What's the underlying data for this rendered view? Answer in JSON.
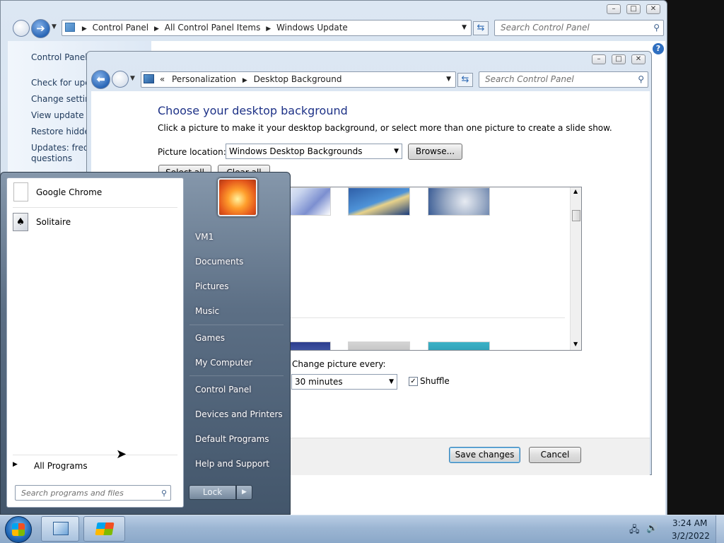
{
  "windows_update": {
    "address": {
      "crumbs": [
        "Control Panel",
        "All Control Panel Items",
        "Windows Update"
      ]
    },
    "search_placeholder": "Search Control Panel",
    "sidebar": {
      "home": "Control Panel H",
      "items": [
        "Check for upda",
        "Change setting",
        "View update hi",
        "Restore hidden",
        "Updates: freque"
      ],
      "items_cont": "questions"
    }
  },
  "personalization": {
    "address": {
      "prefix": "«",
      "crumbs": [
        "Personalization",
        "Desktop Background"
      ]
    },
    "search_placeholder": "Search Control Panel",
    "heading": "Choose your desktop background",
    "instruction": "Click a picture to make it your desktop background, or select more than one picture to create a slide show.",
    "picture_location_label": "Picture location:",
    "picture_location_value": "Windows Desktop Backgrounds",
    "browse_label": "Browse...",
    "select_all_label": "Select all",
    "clear_all_label": "Clear all",
    "change_picture_label": "Change picture every:",
    "interval_value": "30 minutes",
    "shuffle_label": "Shuffle",
    "shuffle_checked": "✓",
    "save_label": "Save changes",
    "cancel_label": "Cancel"
  },
  "start_menu": {
    "pinned": [
      {
        "label": "Google Chrome",
        "icon": "chrome-file-icon"
      },
      {
        "label": "Solitaire",
        "icon": "solitaire-icon"
      }
    ],
    "all_programs": "All Programs",
    "search_placeholder": "Search programs and files",
    "right_items": [
      "VM1",
      "Documents",
      "Pictures",
      "Music",
      "Games",
      "My Computer",
      "Control Panel",
      "Devices and Printers",
      "Default Programs",
      "Help and Support"
    ],
    "lock_label": "Lock"
  },
  "taskbar": {
    "time": "3:24 AM",
    "date": "3/2/2022"
  },
  "colors": {
    "accent_heading": "#1e3287",
    "start_menu_panel": "#4a5c70",
    "taskbar": "#9fb9d6"
  }
}
